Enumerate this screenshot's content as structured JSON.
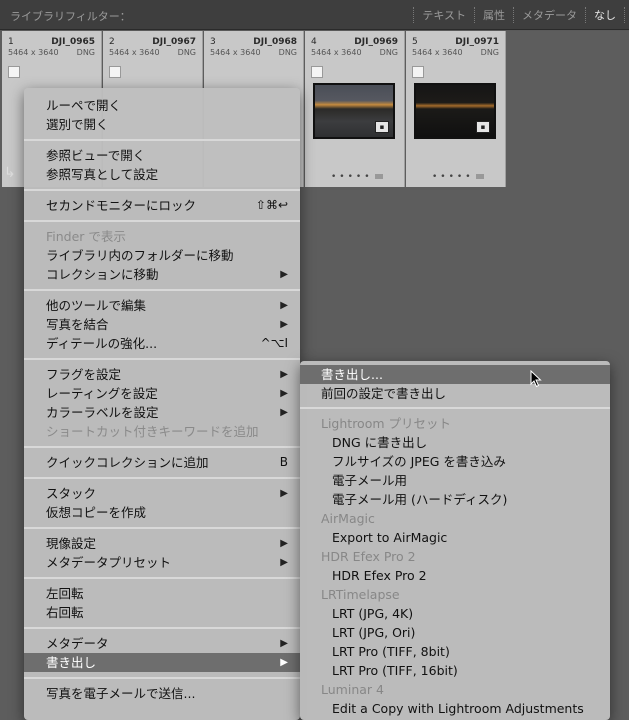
{
  "filter_bar": {
    "title": "ライブラリフィルター：",
    "tabs": [
      "テキスト",
      "属性",
      "メタデータ",
      "なし"
    ]
  },
  "grid": {
    "cells": [
      {
        "num": "1",
        "fname": "DJI_0965",
        "dims": "5464 x 3640",
        "ftype": "DNG"
      },
      {
        "num": "2",
        "fname": "DJI_0967",
        "dims": "5464 x 3640",
        "ftype": "DNG"
      },
      {
        "num": "3",
        "fname": "DJI_0968",
        "dims": "5464 x 3640",
        "ftype": "DNG"
      },
      {
        "num": "4",
        "fname": "DJI_0969",
        "dims": "5464 x 3640",
        "ftype": "DNG"
      },
      {
        "num": "5",
        "fname": "DJI_0971",
        "dims": "5464 x 3640",
        "ftype": "DNG"
      }
    ]
  },
  "context_menu": {
    "items": [
      {
        "label": "ルーペで開く"
      },
      {
        "label": "選別で開く"
      },
      {
        "label": "参照ビューで開く"
      },
      {
        "label": "参照写真として設定"
      },
      {
        "label": "セカンドモニターにロック",
        "shortcut": "⇧⌘↩"
      },
      {
        "label": "Finder で表示"
      },
      {
        "label": "ライブラリ内のフォルダーに移動"
      },
      {
        "label": "コレクションに移動",
        "arrow": "▶"
      },
      {
        "label": "他のツールで編集",
        "arrow": "▶"
      },
      {
        "label": "写真を結合",
        "arrow": "▶"
      },
      {
        "label": "ディテールの強化...",
        "shortcut": "^⌥I"
      },
      {
        "label": "フラグを設定",
        "arrow": "▶"
      },
      {
        "label": "レーティングを設定",
        "arrow": "▶"
      },
      {
        "label": "カラーラベルを設定",
        "arrow": "▶"
      },
      {
        "label": "ショートカット付きキーワードを追加"
      },
      {
        "label": "クイックコレクションに追加",
        "shortcut": "B"
      },
      {
        "label": "スタック",
        "arrow": "▶"
      },
      {
        "label": "仮想コピーを作成"
      },
      {
        "label": "現像設定",
        "arrow": "▶"
      },
      {
        "label": "メタデータプリセット",
        "arrow": "▶"
      },
      {
        "label": "左回転"
      },
      {
        "label": "右回転"
      },
      {
        "label": "メタデータ",
        "arrow": "▶"
      },
      {
        "label": "書き出し",
        "arrow": "▶"
      },
      {
        "label": "写真を電子メールで送信..."
      }
    ]
  },
  "export_submenu": {
    "items": [
      {
        "label": "書き出し..."
      },
      {
        "label": "前回の設定で書き出し"
      },
      {
        "label": "Lightroom プリセット"
      },
      {
        "label": "DNG に書き出し"
      },
      {
        "label": "フルサイズの JPEG を書き込み"
      },
      {
        "label": "電子メール用"
      },
      {
        "label": "電子メール用 (ハードディスク)"
      },
      {
        "label": "AirMagic"
      },
      {
        "label": "Export to AirMagic"
      },
      {
        "label": "HDR Efex Pro 2"
      },
      {
        "label": "HDR Efex Pro 2"
      },
      {
        "label": "LRTimelapse"
      },
      {
        "label": "LRT (JPG, 4K)"
      },
      {
        "label": "LRT (JPG, Ori)"
      },
      {
        "label": "LRT Pro (TIFF, 8bit)"
      },
      {
        "label": "LRT Pro (TIFF, 16bit)"
      },
      {
        "label": "Luminar 4"
      },
      {
        "label": "Edit a Copy with Lightroom Adjustments"
      }
    ]
  },
  "colors": {
    "menu_bg": "#bebebe",
    "highlight": "#6e6e6e",
    "app_bg": "#5a5a5a"
  }
}
